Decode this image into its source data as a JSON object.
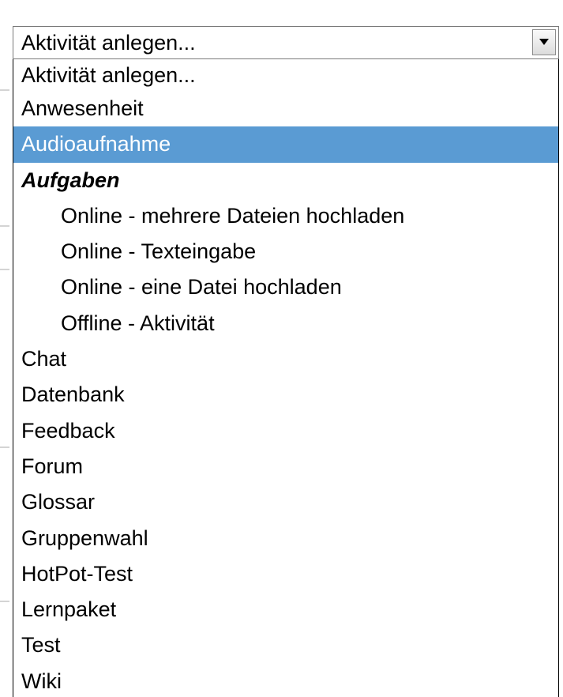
{
  "select": {
    "current_value": "Aktivität anlegen..."
  },
  "options": {
    "placeholder": "Aktivität anlegen...",
    "anwesenheit": "Anwesenheit",
    "audioaufnahme": "Audioaufnahme",
    "aufgaben_group": "Aufgaben",
    "aufgaben_items": [
      "Online - mehrere Dateien hochladen",
      "Online - Texteingabe",
      "Online - eine Datei hochladen",
      "Offline - Aktivität"
    ],
    "items": [
      "Chat",
      "Datenbank",
      "Feedback",
      "Forum",
      "Glossar",
      "Gruppenwahl",
      "HotPot-Test",
      "Lernpaket",
      "Test",
      "Wiki"
    ]
  },
  "selected_option": "Audioaufnahme",
  "colors": {
    "highlight": "#5a9bd3",
    "highlight_text": "#ffffff",
    "border": "#7a7a7a"
  },
  "icons": {
    "dropdown_arrow": "chevron-down-icon"
  }
}
